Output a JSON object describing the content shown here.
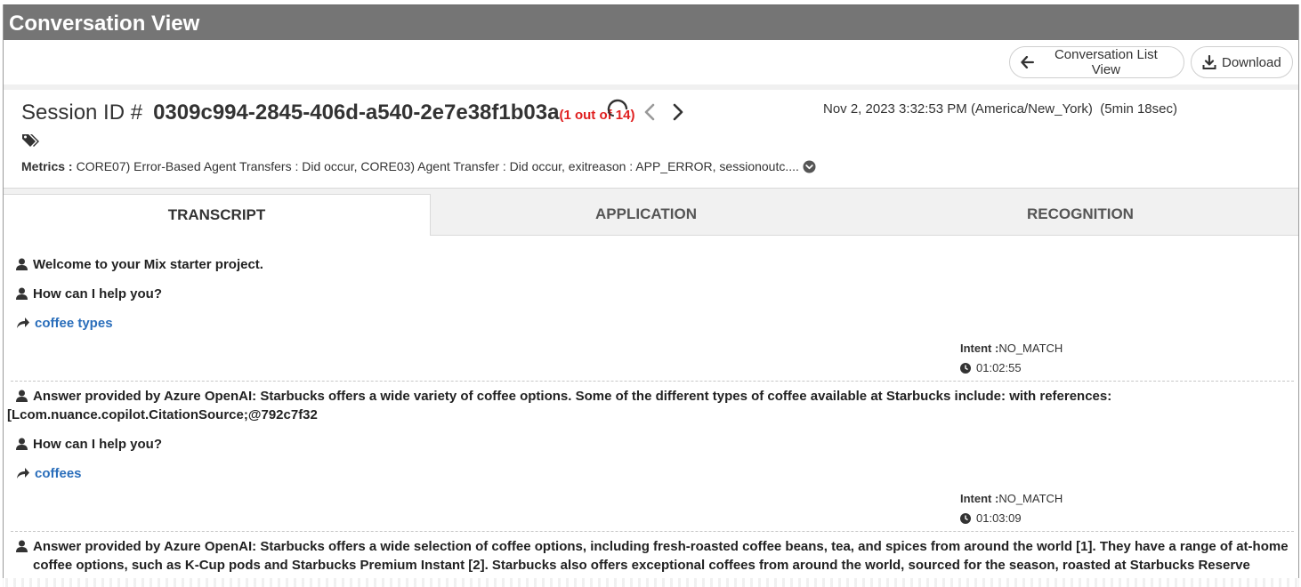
{
  "app": {
    "title": "Conversation View"
  },
  "toolbar": {
    "conversation_list_label": "Conversation List View",
    "download_label": "Download"
  },
  "session": {
    "label": "Session ID #",
    "id": "0309c994-2845-406d-a540-2e7e38f1b03a",
    "count": "(1 out of 14)",
    "datetime": "Nov 2, 2023 3:32:53 PM (America/New_York)",
    "duration": "(5min 18sec)",
    "metrics_label": "Metrics :",
    "metrics_value": "CORE07) Error-Based Agent Transfers : Did occur, CORE03) Agent Transfer : Did occur, exitreason : APP_ERROR, sessionoutc...."
  },
  "tabs": [
    {
      "label": "TRANSCRIPT",
      "active": true
    },
    {
      "label": "APPLICATION",
      "active": false
    },
    {
      "label": "RECOGNITION",
      "active": false
    }
  ],
  "transcript": {
    "turn1": {
      "system_1": "Welcome to your Mix starter project.",
      "system_2": "How can I help you?",
      "user": "coffee types",
      "intent_label": "Intent :",
      "intent_value": "NO_MATCH",
      "time": "01:02:55"
    },
    "turn2": {
      "answer": "Answer provided by Azure OpenAI: Starbucks offers a wide variety of coffee options. Some of the different types of coffee available at Starbucks include: with references:",
      "answer_ref": "[Lcom.nuance.copilot.CitationSource;@792c7f32",
      "system_2": "How can I help you?",
      "user": "coffees",
      "intent_label": "Intent :",
      "intent_value": "NO_MATCH",
      "time": "01:03:09"
    },
    "turn3": {
      "answer": "Answer provided by Azure OpenAI: Starbucks offers a wide selection of coffee options, including fresh-roasted coffee beans, tea, and spices from around the world [1]. They have a range of at-home coffee options, such as K-Cup pods and Starbucks Premium Instant [2]. Starbucks also offers exceptional coffees from around the world, sourced for the season, roasted at Starbucks Reserve"
    }
  },
  "colors": {
    "titlebar": "#757575",
    "link": "#2a6ebb",
    "count": "#e02020"
  }
}
